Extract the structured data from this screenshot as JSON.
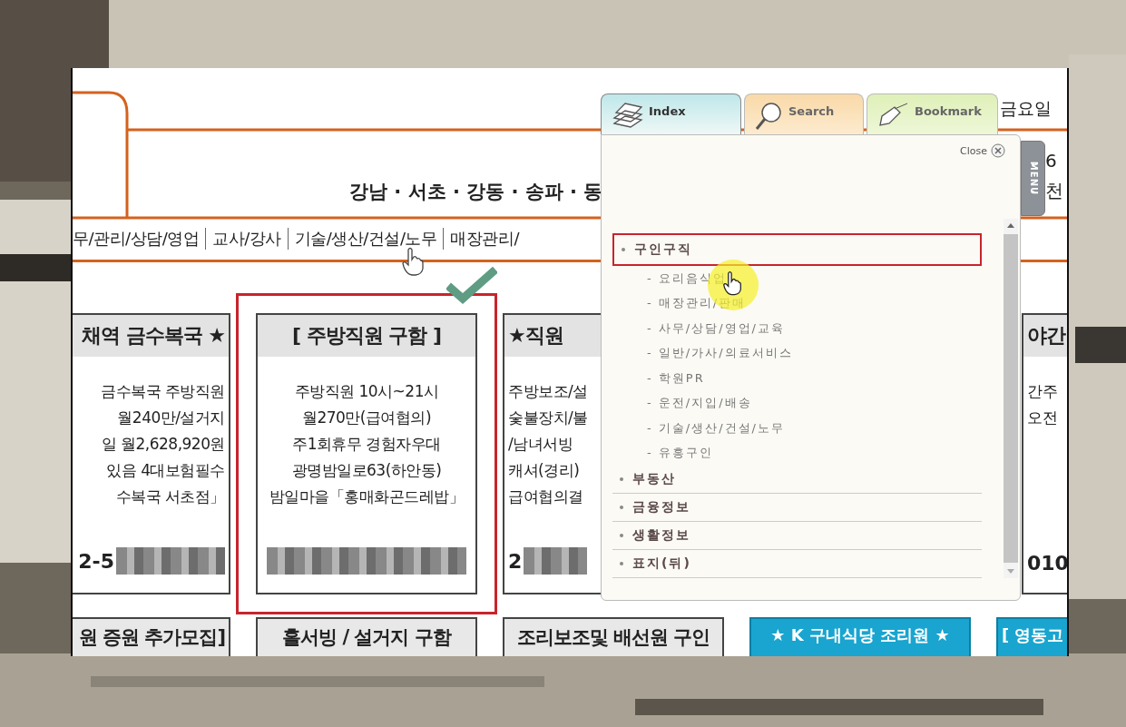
{
  "newspaper": {
    "region_text": "강남 · 서초 · 강동 · 송파 · 동",
    "date_fragment": "금요일",
    "edge_fragments": [
      "6",
      "천"
    ],
    "categories": [
      "무/관리/상담/영업",
      "교사/강사",
      "기술/생산/건설/노무",
      "매장관리/"
    ],
    "ads_top": [
      {
        "title": "채역 금수복국 ★",
        "lines": [
          "금수복국 주방직원",
          "월240만/설거지",
          "일 월2,628,920원",
          "있음 4대보험필수",
          "수복국 서초점」"
        ],
        "phone": "2-5",
        "highlighted": false
      },
      {
        "title": "[ 주방직원 구함 ]",
        "lines": [
          "주방직원 10시~21시",
          "월270만(급여협의)",
          "주1회휴무 경험자우대",
          "광명밤일로63(하안동)",
          "밤일마을「홍매화곤드레밥」"
        ],
        "highlighted": true
      },
      {
        "title": "★직원",
        "lines": [
          "주방보조/설",
          "숯불장치/불",
          "/남녀서빙",
          "캐셔(경리)",
          "급여협의결"
        ],
        "phone": "2",
        "highlighted": false
      },
      {
        "title": "야간",
        "lines": [
          "간주",
          "오전"
        ],
        "phone": "010",
        "highlighted": false
      }
    ],
    "ads_bottom": [
      {
        "title": "원 증원 추가모집]",
        "kind": "plain"
      },
      {
        "title": "홀서빙 / 설거지 구함",
        "kind": "plain"
      },
      {
        "title": "조리보조및 배선원 구인",
        "kind": "plain"
      },
      {
        "title": "★ K 구내식당 조리원 ★",
        "kind": "blue"
      },
      {
        "title": "[ 영동고",
        "kind": "blue"
      }
    ]
  },
  "index_panel": {
    "tabs": [
      {
        "label": "Index",
        "selected": true
      },
      {
        "label": "Search",
        "selected": false
      },
      {
        "label": "Bookmark",
        "selected": false
      }
    ],
    "close_label": "Close",
    "side_tab": "MENU",
    "items": [
      {
        "label": "구인구직",
        "selected": true,
        "children": [
          "- 요리음식업",
          "- 매장관리/판매",
          "- 사무/상담/영업/교육",
          "- 일반/가사/의료서비스",
          "- 학원PR",
          "- 운전/지입/배송",
          "- 기술/생산/건설/노무",
          "- 유흥구인"
        ]
      },
      {
        "label": "부동산",
        "selected": false
      },
      {
        "label": "금융정보",
        "selected": false
      },
      {
        "label": "생활정보",
        "selected": false
      },
      {
        "label": "표지(뒤)",
        "selected": false
      }
    ]
  }
}
